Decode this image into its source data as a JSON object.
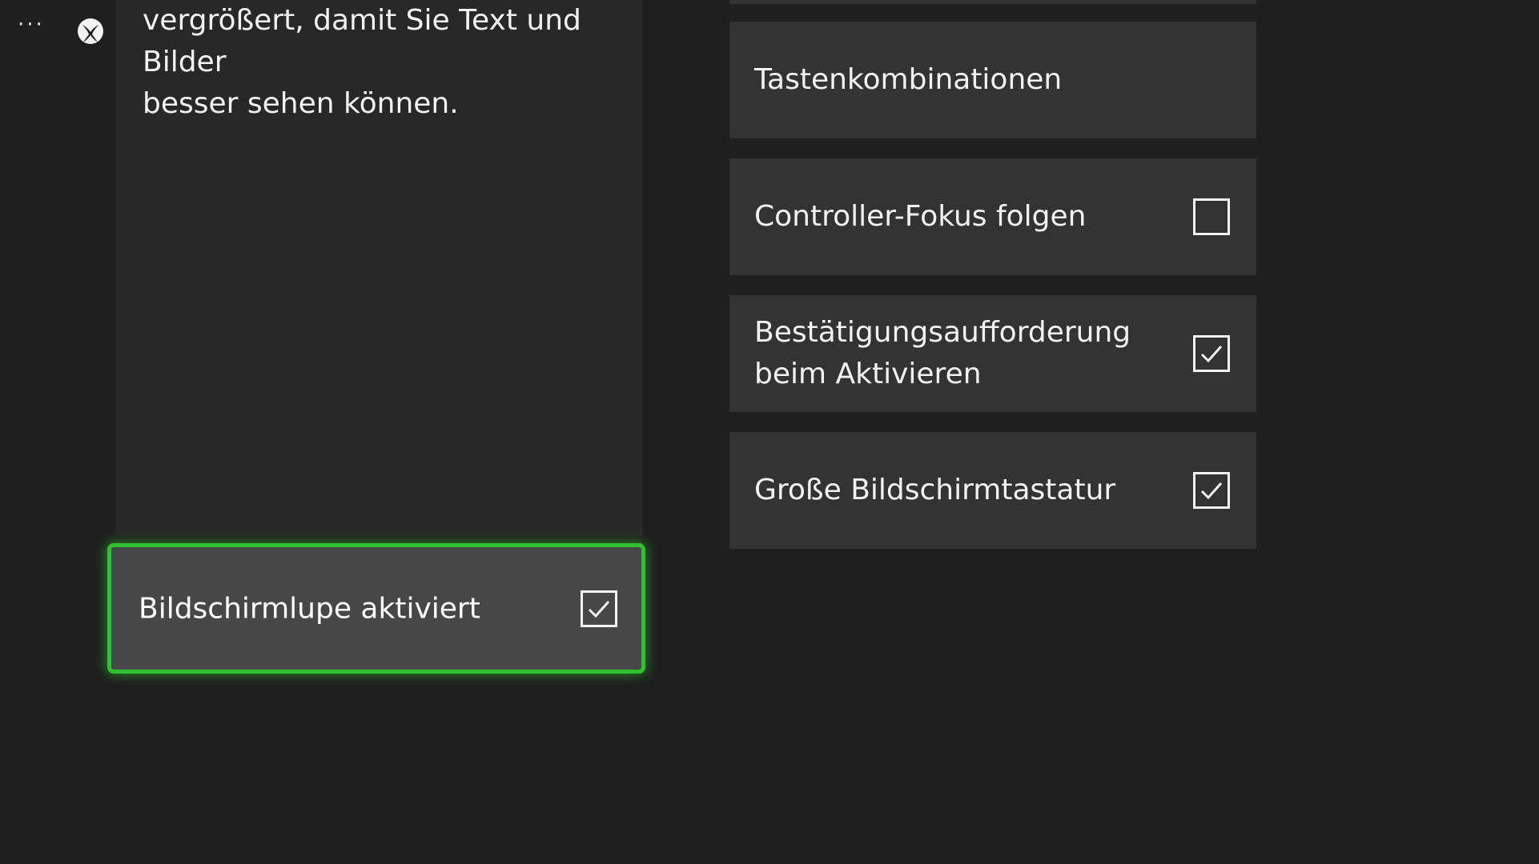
{
  "header": {
    "more_icon_glyph": "···",
    "logo_icon": "xbox-logo-icon"
  },
  "description": {
    "lines": [
      "vergrößert, damit Sie Text und",
      "Bilder",
      "besser sehen können."
    ]
  },
  "magnifier_toggle": {
    "label": "Bildschirmlupe aktiviert",
    "checked": true
  },
  "options": [
    {
      "label": "Tastenkombinationen",
      "has_checkbox": false
    },
    {
      "label": "Controller-Fokus folgen",
      "has_checkbox": true,
      "checked": false
    },
    {
      "label_lines": [
        "Bestätigungsaufforderung",
        "beim Aktivieren"
      ],
      "has_checkbox": true,
      "checked": true
    },
    {
      "label": "Große Bildschirmtastatur",
      "has_checkbox": true,
      "checked": true
    }
  ],
  "colors": {
    "background": "#1f1f1f",
    "panel": "#282828",
    "option_bg": "#333333",
    "focus_bg": "#474747",
    "focus_border": "#2ec22e",
    "text": "#f2f2f2"
  }
}
